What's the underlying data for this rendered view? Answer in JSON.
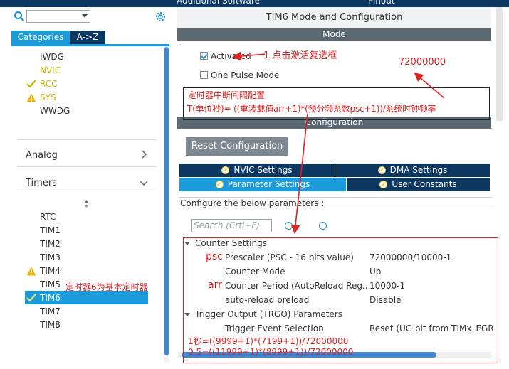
{
  "top_bar": {
    "left_text": "Additional Software",
    "right_text": "Pinout"
  },
  "left_panel": {
    "search": {
      "value": ""
    },
    "tabs": [
      {
        "label": "Categories"
      },
      {
        "label": "A->Z"
      }
    ],
    "system_items": [
      {
        "label": "IWDG",
        "status": "none"
      },
      {
        "label": "NVIC",
        "status": "none"
      },
      {
        "label": "RCC",
        "status": "ok"
      },
      {
        "label": "SYS",
        "status": "warning"
      },
      {
        "label": "WWDG",
        "status": "none"
      }
    ],
    "categories": [
      {
        "label": "Analog"
      },
      {
        "label": "Timers"
      }
    ],
    "timer_items": [
      {
        "label": "RTC",
        "status": "none"
      },
      {
        "label": "TIM1",
        "status": "none"
      },
      {
        "label": "TIM2",
        "status": "none"
      },
      {
        "label": "TIM3",
        "status": "none"
      },
      {
        "label": "TIM4",
        "status": "warning"
      },
      {
        "label": "TIM5",
        "status": "none"
      },
      {
        "label": "TIM6",
        "status": "ok",
        "selected": true
      },
      {
        "label": "TIM7",
        "status": "none"
      },
      {
        "label": "TIM8",
        "status": "none"
      }
    ]
  },
  "right_panel": {
    "title": "TIM6 Mode and Configuration",
    "mode_header": "Mode",
    "activated": {
      "label": "Activated",
      "checked": true
    },
    "one_pulse": {
      "label": "One Pulse Mode",
      "checked": false
    },
    "config_header": "Configuration",
    "reset_button": "Reset Configuration",
    "tabs_row1": [
      {
        "label": "NVIC Settings"
      },
      {
        "label": "DMA Settings"
      }
    ],
    "tabs_row2": [
      {
        "label": "Parameter Settings"
      },
      {
        "label": "User Constants"
      }
    ],
    "configure_text": "Configure the below parameters :",
    "search_placeholder": "Search (Crtl+F)",
    "groups": [
      {
        "title": "Counter Settings",
        "params": [
          {
            "label": "Prescaler (PSC - 16 bits value)",
            "value": "72000000/10000-1"
          },
          {
            "label": "Counter Mode",
            "value": "Up"
          },
          {
            "label": "Counter Period (AutoReload Reg...",
            "value": "10000-1"
          },
          {
            "label": "auto-reload preload",
            "value": "Disable"
          }
        ]
      },
      {
        "title": "Trigger Output (TRGO) Parameters",
        "params": [
          {
            "label": "Trigger Event Selection",
            "value": "Reset (UG bit from TIMx_EGR"
          }
        ]
      }
    ]
  },
  "annotations": {
    "click_activate": "1.点击激活复选框",
    "clock_value": "72000000",
    "interval_title": "定时器中断间隔配置",
    "formula": "T(单位秒)= ((重装载值arr+1)*(预分频系数psc+1))/系统时钟频率",
    "psc": "psc",
    "arr": "arr",
    "tim6_note": "定时器6为基本定时器",
    "calc1": "1秒=((9999+1)*(7199+1))/72000000",
    "calc2": "0.5=((11999+1)*(8999+1))/72000000"
  },
  "colors": {
    "accent": "#1b9bd9",
    "dark_tab": "#0b3761",
    "header_gray": "#5a6872",
    "annotation_red": "#e02020",
    "status_ok": "#c8b400",
    "status_warn": "#f4b400"
  }
}
